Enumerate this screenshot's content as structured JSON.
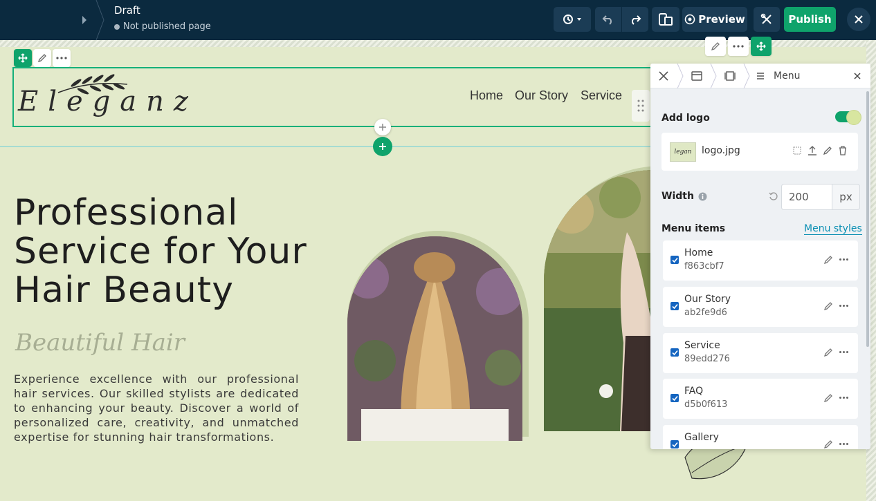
{
  "topbar": {
    "title": "Draft",
    "status": "Not published page",
    "preview_label": "Preview",
    "publish_label": "Publish",
    "colors": {
      "bar": "#0b2a3f",
      "publish": "#0fa36b"
    }
  },
  "site": {
    "logo_text": "Eleganz",
    "nav": [
      "Home",
      "Our Story",
      "Service"
    ],
    "hero_title": "Professional Service for Your Hair Beauty",
    "hero_subtitle": "Beautiful Hair",
    "hero_body": "Experience excellence with our professional hair services. Our skilled stylists are dedicated to enhancing your beauty. Discover a world of personalized care, creativity, and unmatched expertise for stunning hair transformations."
  },
  "panel": {
    "title": "Menu",
    "add_logo_label": "Add logo",
    "add_logo_enabled": true,
    "logo_file": "logo.jpg",
    "logo_thumb_text": "legan",
    "width_label": "Width",
    "width_value": "200",
    "width_unit": "px",
    "menu_items_label": "Menu items",
    "menu_styles_label": "Menu styles",
    "menu_items": [
      {
        "label": "Home",
        "id": "f863cbf7",
        "checked": true
      },
      {
        "label": "Our Story",
        "id": "ab2fe9d6",
        "checked": true
      },
      {
        "label": "Service",
        "id": "89edd276",
        "checked": true
      },
      {
        "label": "FAQ",
        "id": "d5b0f613",
        "checked": true
      },
      {
        "label": "Gallery",
        "id": "",
        "checked": true
      }
    ]
  }
}
